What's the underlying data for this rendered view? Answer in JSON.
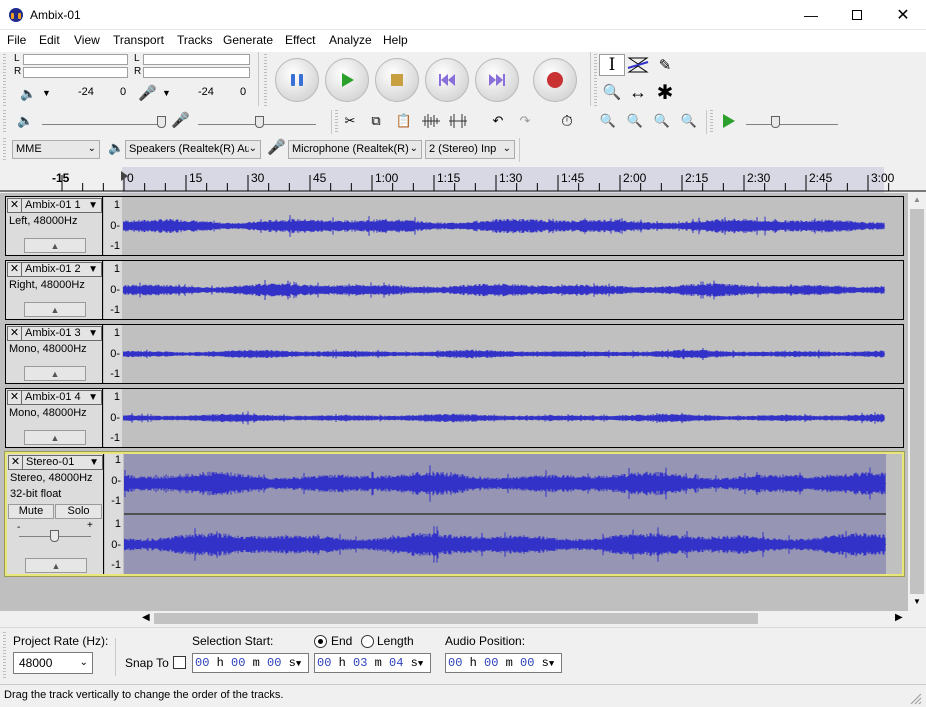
{
  "window": {
    "title": "Ambix-01",
    "minimize_icon": "minimize-icon",
    "maximize_icon": "maximize-icon",
    "close_icon": "close-icon"
  },
  "menu": [
    "File",
    "Edit",
    "View",
    "Transport",
    "Tracks",
    "Generate",
    "Effect",
    "Analyze",
    "Help"
  ],
  "meters": {
    "record_ticks": [
      "-24",
      "0"
    ],
    "playback_ticks": [
      "-24",
      "0"
    ],
    "channel_labels": [
      "L",
      "R"
    ]
  },
  "device": {
    "host": "MME",
    "output": "Speakers (Realtek(R) Au",
    "input": "Microphone (Realtek(R)",
    "channels": "2 (Stereo) Inp"
  },
  "ruler_ticks": [
    "-15",
    "0",
    "15",
    "30",
    "45",
    "1:00",
    "1:15",
    "1:30",
    "1:45",
    "2:00",
    "2:15",
    "2:30",
    "2:45",
    "3:00"
  ],
  "tracks": [
    {
      "name": "Ambix-01 1",
      "info": "Left, 48000Hz",
      "amp": 0.28
    },
    {
      "name": "Ambix-01 2",
      "info": "Right, 48000Hz",
      "amp": 0.24
    },
    {
      "name": "Ambix-01 3",
      "info": "Mono, 48000Hz",
      "amp": 0.15
    },
    {
      "name": "Ambix-01 4",
      "info": "Mono, 48000Hz",
      "amp": 0.15
    },
    {
      "name": "Stereo-01",
      "info": "Stereo, 48000Hz",
      "info2": "32-bit float",
      "amp": 0.42,
      "mute": "Mute",
      "solo": "Solo"
    }
  ],
  "vruler_labels": [
    "1",
    "0-",
    "-1"
  ],
  "selection": {
    "rate_label": "Project Rate (Hz):",
    "rate_value": "48000",
    "snap_label": "Snap To",
    "start_label": "Selection Start:",
    "end_label": "End",
    "length_label": "Length",
    "position_label": "Audio Position:",
    "start_time": {
      "h": "00",
      "m": "00",
      "s": "00"
    },
    "end_time": {
      "h": "00",
      "m": "03",
      "s": "04"
    },
    "position_time": {
      "h": "00",
      "m": "00",
      "s": "00"
    }
  },
  "status": "Drag the track vertically to change the order of the tracks.",
  "colors": {
    "waveform": "#3232c8",
    "wave_bg": "#c0c0c0",
    "selected_bg": "#9696b4",
    "play_green": "#2ca02c",
    "record_red": "#c83232"
  }
}
